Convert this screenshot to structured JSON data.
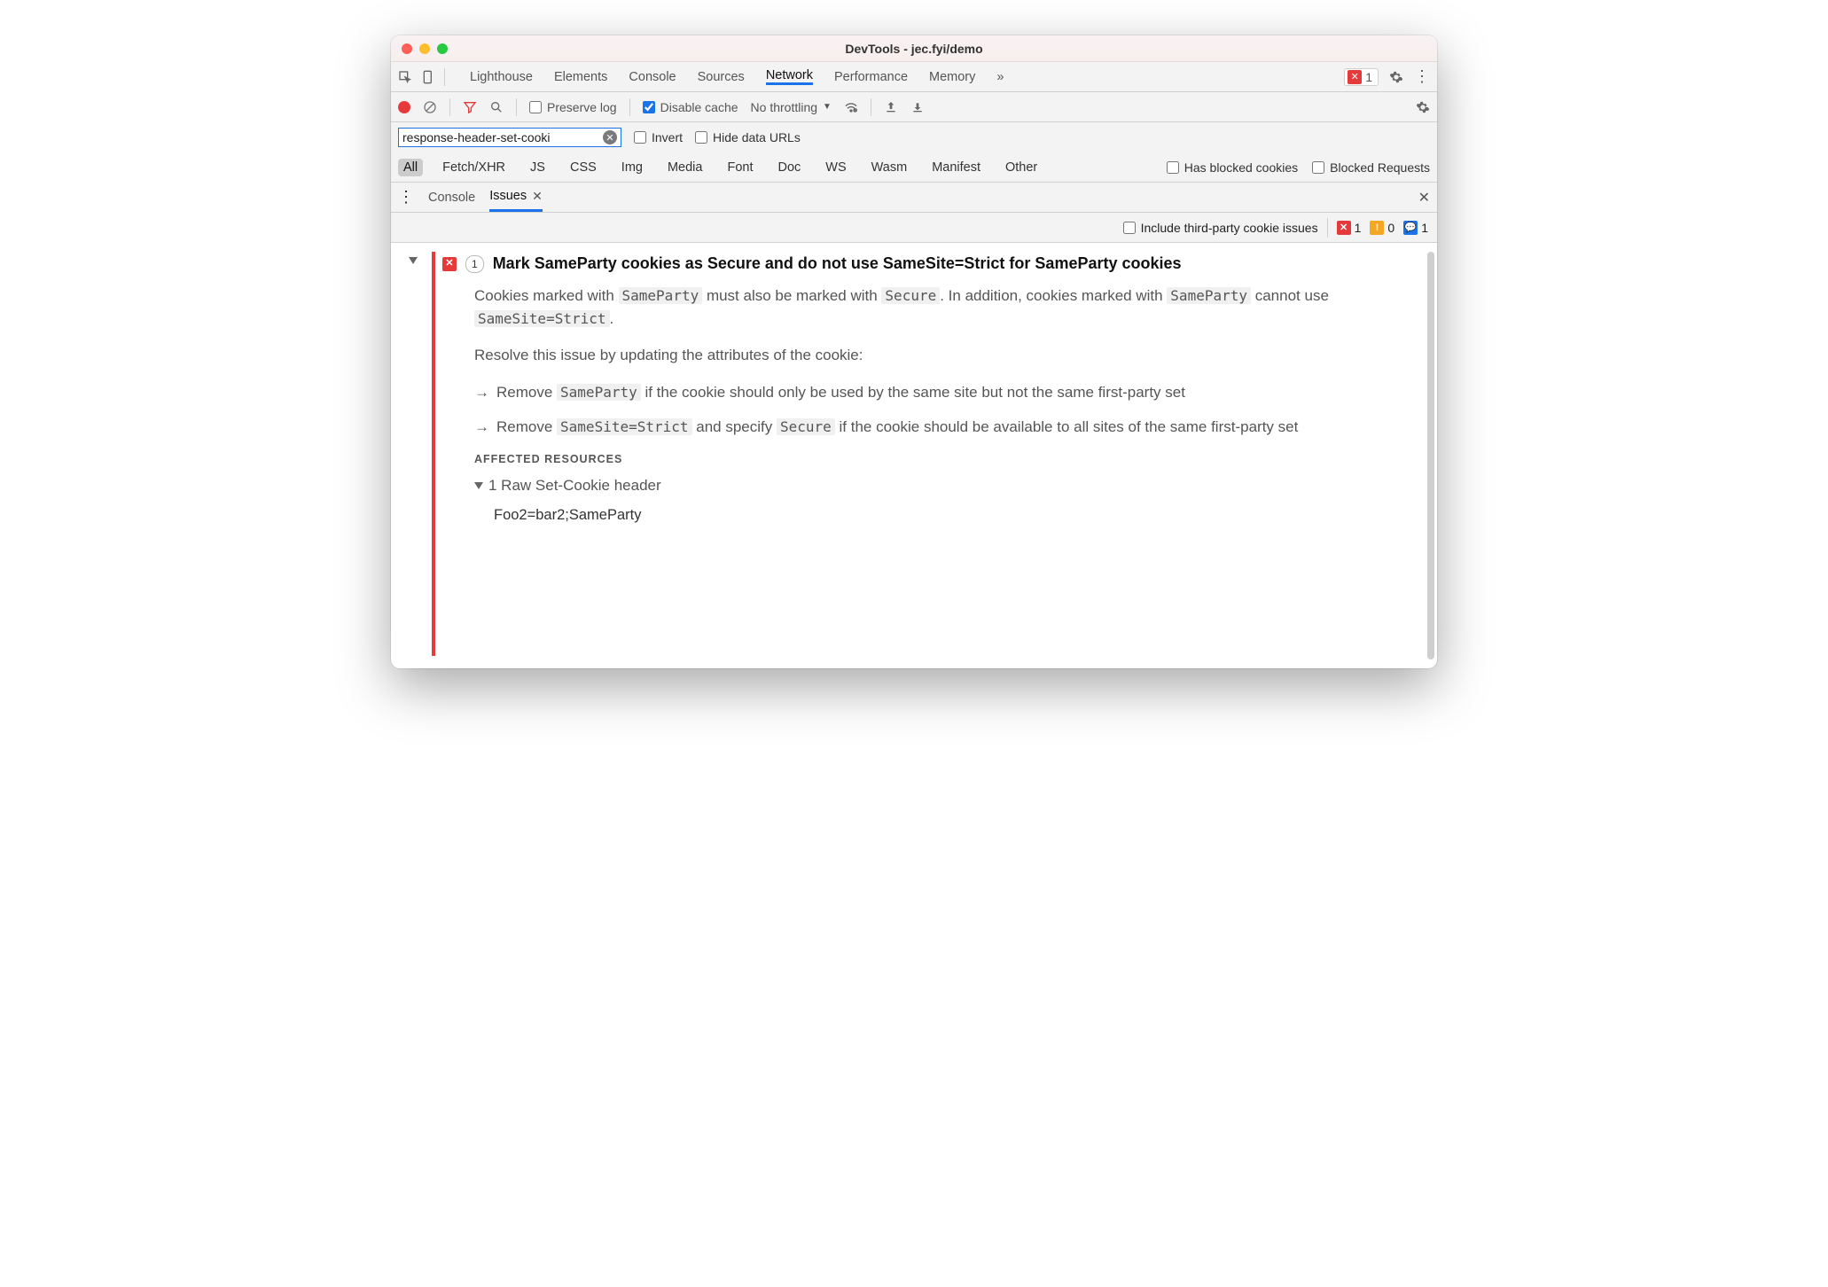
{
  "window": {
    "title": "DevTools - jec.fyi/demo"
  },
  "tabs": {
    "items": [
      "Lighthouse",
      "Elements",
      "Console",
      "Sources",
      "Network",
      "Performance",
      "Memory"
    ],
    "active": "Network",
    "overflow_icon": "chevron-double-right",
    "error_count": "1"
  },
  "toolbar": {
    "preserve_log_label": "Preserve log",
    "preserve_log_checked": false,
    "disable_cache_label": "Disable cache",
    "disable_cache_checked": true,
    "throttling": "No throttling"
  },
  "filter": {
    "value": "response-header-set-cooki",
    "invert_label": "Invert",
    "hide_urls_label": "Hide data URLs"
  },
  "types": {
    "items": [
      "All",
      "Fetch/XHR",
      "JS",
      "CSS",
      "Img",
      "Media",
      "Font",
      "Doc",
      "WS",
      "Wasm",
      "Manifest",
      "Other"
    ],
    "active": "All",
    "has_blocked_label": "Has blocked cookies",
    "blocked_reqs_label": "Blocked Requests"
  },
  "drawer": {
    "tabs": [
      "Console",
      "Issues"
    ],
    "active": "Issues"
  },
  "issues_toolbar": {
    "include_third_party_label": "Include third-party cookie issues",
    "error_count": "1",
    "warn_count": "0",
    "info_count": "1"
  },
  "issue": {
    "count": "1",
    "title": "Mark SameParty cookies as Secure and do not use SameSite=Strict for SameParty cookies",
    "para1_a": "Cookies marked with ",
    "para1_b": " must also be marked with ",
    "para1_c": ". In addition, cookies marked with ",
    "para1_d": " cannot use ",
    "para1_e": ".",
    "code_sameparty": "SameParty",
    "code_secure": "Secure",
    "code_samesite": "SameSite=Strict",
    "para2": "Resolve this issue by updating the attributes of the cookie:",
    "bullet1_a": "Remove ",
    "bullet1_b": " if the cookie should only be used by the same site but not the same first-party set",
    "bullet2_a": "Remove ",
    "bullet2_b": " and specify ",
    "bullet2_c": " if the cookie should be available to all sites of the same first-party set",
    "affected_h": "AFFECTED RESOURCES",
    "raw_header_label": "1 Raw Set-Cookie header",
    "cookie_value": "Foo2=bar2;SameParty"
  }
}
